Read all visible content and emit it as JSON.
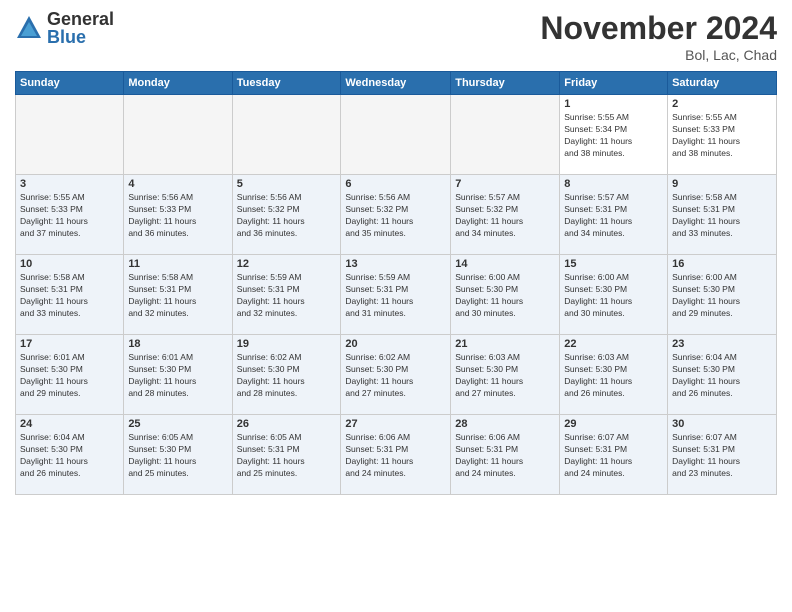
{
  "header": {
    "logo_general": "General",
    "logo_blue": "Blue",
    "month_title": "November 2024",
    "location": "Bol, Lac, Chad"
  },
  "weekdays": [
    "Sunday",
    "Monday",
    "Tuesday",
    "Wednesday",
    "Thursday",
    "Friday",
    "Saturday"
  ],
  "weeks": [
    [
      {
        "day": "",
        "info": ""
      },
      {
        "day": "",
        "info": ""
      },
      {
        "day": "",
        "info": ""
      },
      {
        "day": "",
        "info": ""
      },
      {
        "day": "",
        "info": ""
      },
      {
        "day": "1",
        "info": "Sunrise: 5:55 AM\nSunset: 5:34 PM\nDaylight: 11 hours\nand 38 minutes."
      },
      {
        "day": "2",
        "info": "Sunrise: 5:55 AM\nSunset: 5:33 PM\nDaylight: 11 hours\nand 38 minutes."
      }
    ],
    [
      {
        "day": "3",
        "info": "Sunrise: 5:55 AM\nSunset: 5:33 PM\nDaylight: 11 hours\nand 37 minutes."
      },
      {
        "day": "4",
        "info": "Sunrise: 5:56 AM\nSunset: 5:33 PM\nDaylight: 11 hours\nand 36 minutes."
      },
      {
        "day": "5",
        "info": "Sunrise: 5:56 AM\nSunset: 5:32 PM\nDaylight: 11 hours\nand 36 minutes."
      },
      {
        "day": "6",
        "info": "Sunrise: 5:56 AM\nSunset: 5:32 PM\nDaylight: 11 hours\nand 35 minutes."
      },
      {
        "day": "7",
        "info": "Sunrise: 5:57 AM\nSunset: 5:32 PM\nDaylight: 11 hours\nand 34 minutes."
      },
      {
        "day": "8",
        "info": "Sunrise: 5:57 AM\nSunset: 5:31 PM\nDaylight: 11 hours\nand 34 minutes."
      },
      {
        "day": "9",
        "info": "Sunrise: 5:58 AM\nSunset: 5:31 PM\nDaylight: 11 hours\nand 33 minutes."
      }
    ],
    [
      {
        "day": "10",
        "info": "Sunrise: 5:58 AM\nSunset: 5:31 PM\nDaylight: 11 hours\nand 33 minutes."
      },
      {
        "day": "11",
        "info": "Sunrise: 5:58 AM\nSunset: 5:31 PM\nDaylight: 11 hours\nand 32 minutes."
      },
      {
        "day": "12",
        "info": "Sunrise: 5:59 AM\nSunset: 5:31 PM\nDaylight: 11 hours\nand 32 minutes."
      },
      {
        "day": "13",
        "info": "Sunrise: 5:59 AM\nSunset: 5:31 PM\nDaylight: 11 hours\nand 31 minutes."
      },
      {
        "day": "14",
        "info": "Sunrise: 6:00 AM\nSunset: 5:30 PM\nDaylight: 11 hours\nand 30 minutes."
      },
      {
        "day": "15",
        "info": "Sunrise: 6:00 AM\nSunset: 5:30 PM\nDaylight: 11 hours\nand 30 minutes."
      },
      {
        "day": "16",
        "info": "Sunrise: 6:00 AM\nSunset: 5:30 PM\nDaylight: 11 hours\nand 29 minutes."
      }
    ],
    [
      {
        "day": "17",
        "info": "Sunrise: 6:01 AM\nSunset: 5:30 PM\nDaylight: 11 hours\nand 29 minutes."
      },
      {
        "day": "18",
        "info": "Sunrise: 6:01 AM\nSunset: 5:30 PM\nDaylight: 11 hours\nand 28 minutes."
      },
      {
        "day": "19",
        "info": "Sunrise: 6:02 AM\nSunset: 5:30 PM\nDaylight: 11 hours\nand 28 minutes."
      },
      {
        "day": "20",
        "info": "Sunrise: 6:02 AM\nSunset: 5:30 PM\nDaylight: 11 hours\nand 27 minutes."
      },
      {
        "day": "21",
        "info": "Sunrise: 6:03 AM\nSunset: 5:30 PM\nDaylight: 11 hours\nand 27 minutes."
      },
      {
        "day": "22",
        "info": "Sunrise: 6:03 AM\nSunset: 5:30 PM\nDaylight: 11 hours\nand 26 minutes."
      },
      {
        "day": "23",
        "info": "Sunrise: 6:04 AM\nSunset: 5:30 PM\nDaylight: 11 hours\nand 26 minutes."
      }
    ],
    [
      {
        "day": "24",
        "info": "Sunrise: 6:04 AM\nSunset: 5:30 PM\nDaylight: 11 hours\nand 26 minutes."
      },
      {
        "day": "25",
        "info": "Sunrise: 6:05 AM\nSunset: 5:30 PM\nDaylight: 11 hours\nand 25 minutes."
      },
      {
        "day": "26",
        "info": "Sunrise: 6:05 AM\nSunset: 5:31 PM\nDaylight: 11 hours\nand 25 minutes."
      },
      {
        "day": "27",
        "info": "Sunrise: 6:06 AM\nSunset: 5:31 PM\nDaylight: 11 hours\nand 24 minutes."
      },
      {
        "day": "28",
        "info": "Sunrise: 6:06 AM\nSunset: 5:31 PM\nDaylight: 11 hours\nand 24 minutes."
      },
      {
        "day": "29",
        "info": "Sunrise: 6:07 AM\nSunset: 5:31 PM\nDaylight: 11 hours\nand 24 minutes."
      },
      {
        "day": "30",
        "info": "Sunrise: 6:07 AM\nSunset: 5:31 PM\nDaylight: 11 hours\nand 23 minutes."
      }
    ]
  ]
}
